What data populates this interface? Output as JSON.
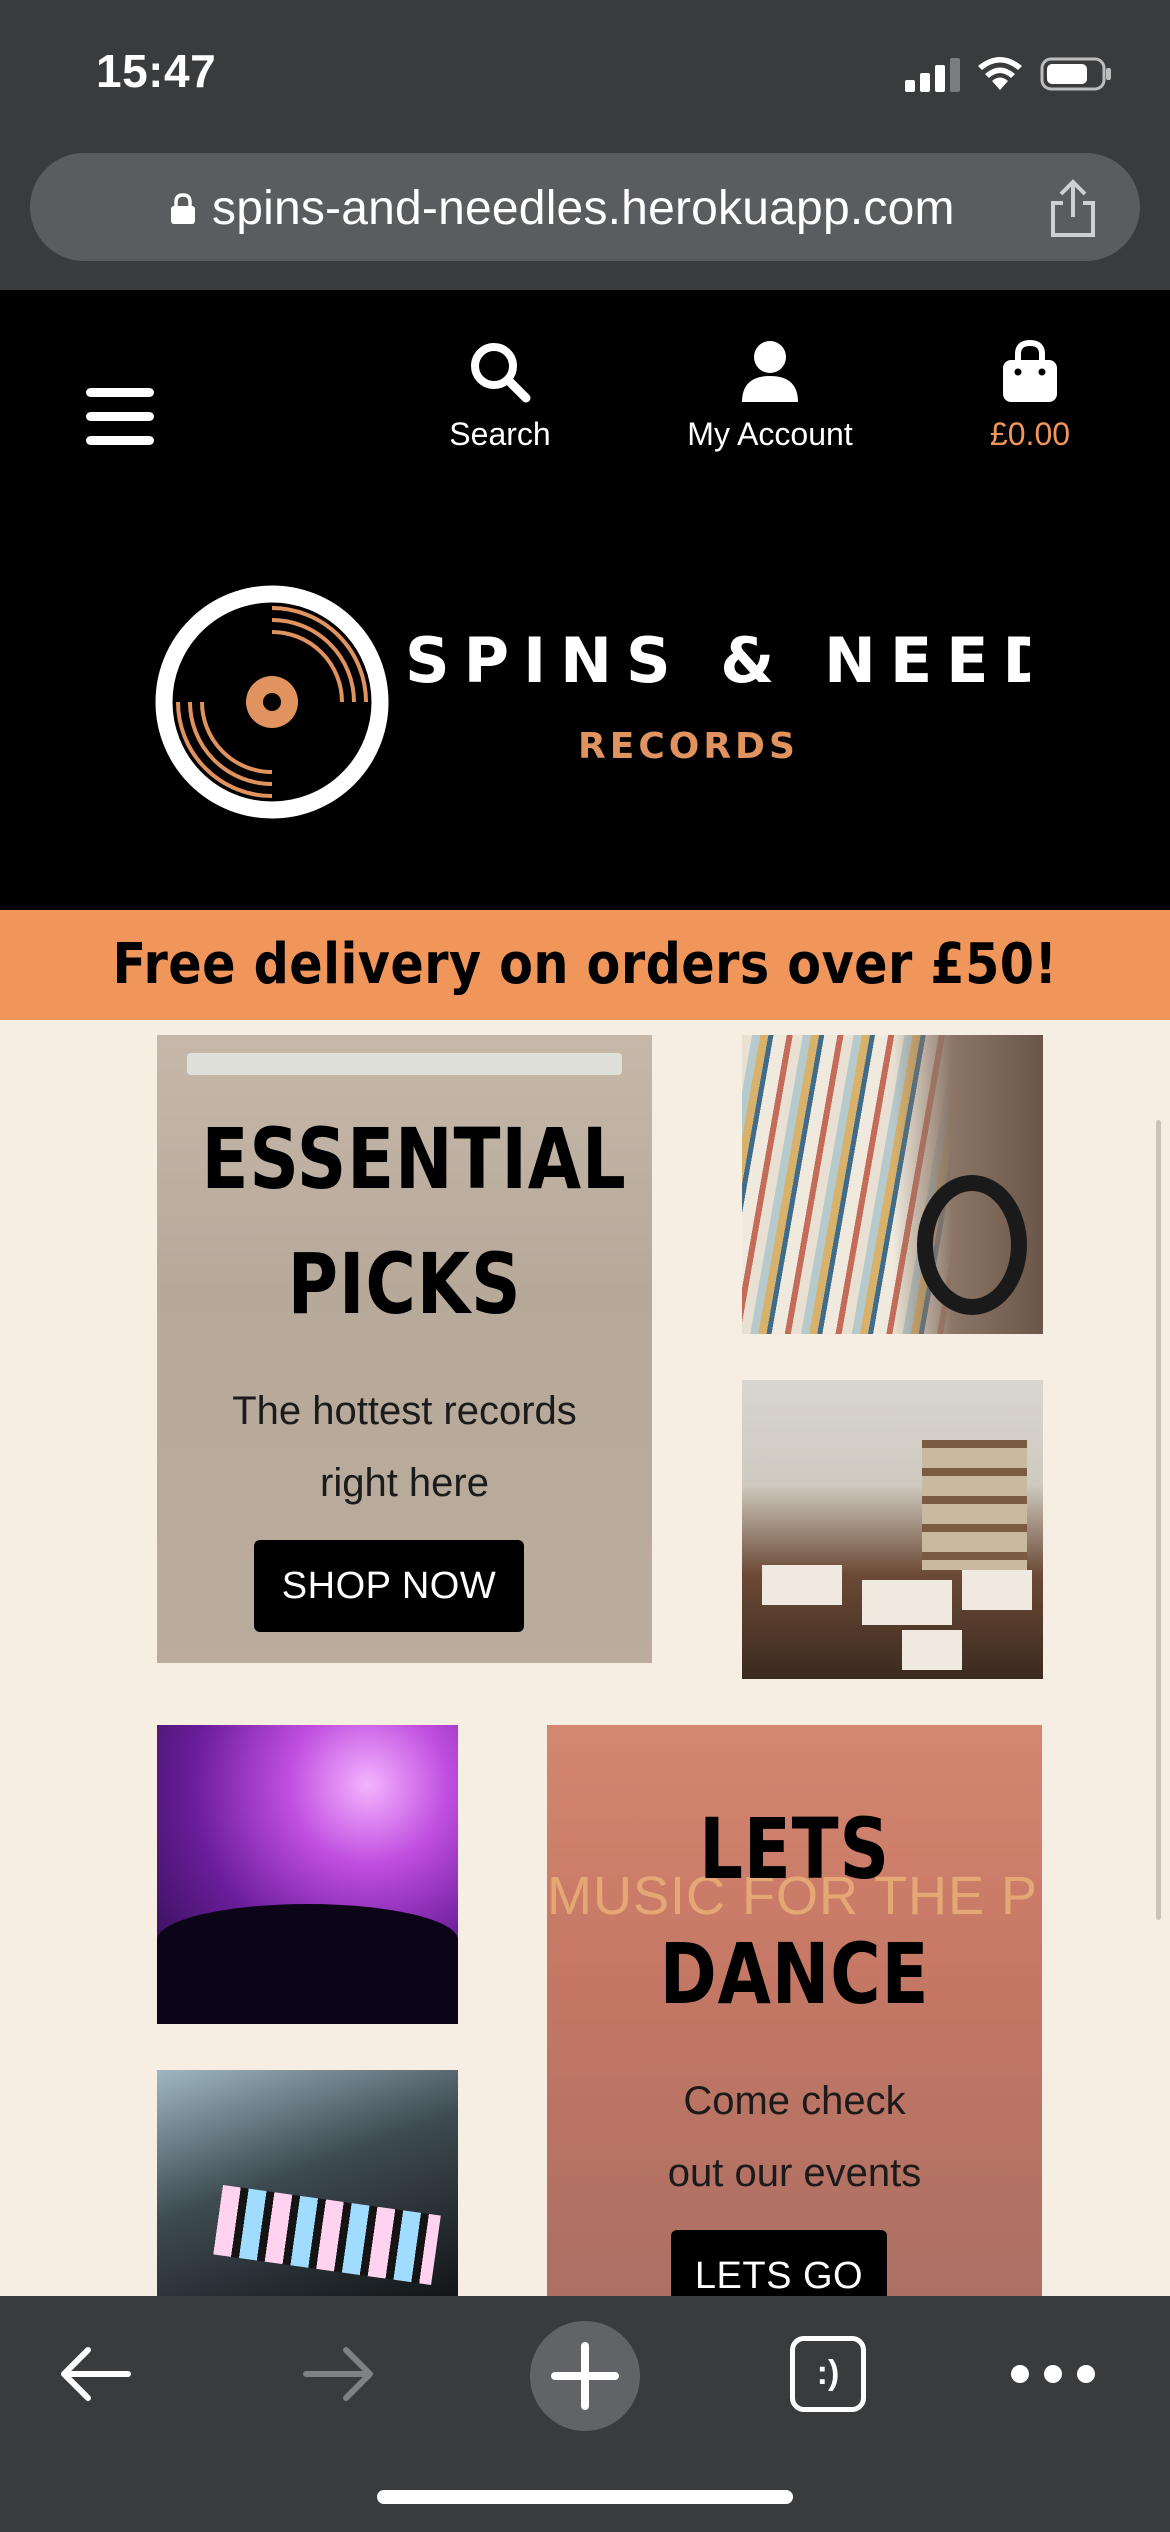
{
  "status_bar": {
    "time": "15:47"
  },
  "browser": {
    "url": "spins-and-needles.herokuapp.com"
  },
  "header": {
    "nav": {
      "search_label": "Search",
      "account_label": "My Account",
      "cart_total": "£0.00"
    },
    "logo": {
      "brand_name": "SPINS & NEEDLES",
      "brand_sub": "RECORDS"
    }
  },
  "banner": {
    "text": "Free delivery on orders over £50!"
  },
  "hero_essential": {
    "title_line1": "ESSENTIAL",
    "title_line2": "PICKS",
    "subtitle_line1": "The hottest records",
    "subtitle_line2": "right here",
    "cta": "SHOP NOW"
  },
  "hero_dance": {
    "title_line1": "LETS",
    "title_line2": "DANCE",
    "subtitle_line1": "Come check",
    "subtitle_line2": "out our events",
    "cta": "LETS GO",
    "neon_sign": "MUSIC FOR THE PEOPLE"
  },
  "toolbar": {
    "tabs_glyph": ":)"
  },
  "colors": {
    "accent": "#f0965a",
    "page_bg": "#f6eee3",
    "header_bg": "#000000",
    "chrome_bg": "#3a3b3d"
  },
  "icons": [
    "menu-icon",
    "search-icon",
    "account-icon",
    "bag-icon",
    "lock-icon",
    "share-icon",
    "back-icon",
    "forward-icon",
    "new-tab-icon",
    "tabs-icon",
    "more-icon"
  ]
}
